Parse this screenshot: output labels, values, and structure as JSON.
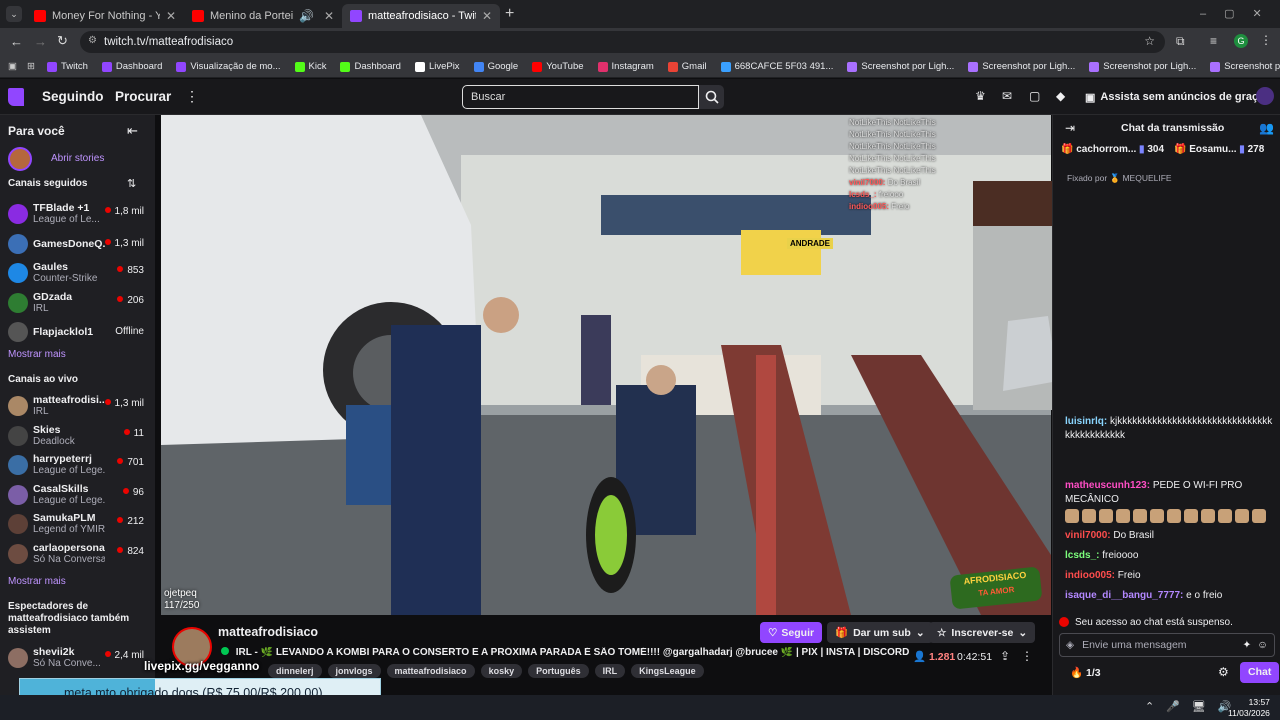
{
  "browser": {
    "tabs": [
      {
        "title": "Money For Nothing - YouTube",
        "color": "#ff0000"
      },
      {
        "title": "Menino da Porteira Versão Dire",
        "color": "#ff0000"
      },
      {
        "title": "matteafrodisiaco - Twitch",
        "color": "#9146ff"
      }
    ],
    "new_tab": "+",
    "url": "twitch.tv/matteafrodisiaco",
    "bookmarks": [
      {
        "label": "Twitch",
        "color": "#9146ff"
      },
      {
        "label": "Dashboard",
        "color": "#9146ff"
      },
      {
        "label": "Visualização de mo...",
        "color": "#9146ff"
      },
      {
        "label": "Kick",
        "color": "#53fc18"
      },
      {
        "label": "Dashboard",
        "color": "#53fc18"
      },
      {
        "label": "LivePix",
        "color": "#ffffff"
      },
      {
        "label": "Google",
        "color": "#4285f4"
      },
      {
        "label": "YouTube",
        "color": "#ff0000"
      },
      {
        "label": "Instagram",
        "color": "#e1306c"
      },
      {
        "label": "Gmail",
        "color": "#ea4335"
      },
      {
        "label": "668CAFCE 5F03 491...",
        "color": "#3aa0ff"
      },
      {
        "label": "Screenshot por Ligh...",
        "color": "#a970ff"
      },
      {
        "label": "Screenshot por Ligh...",
        "color": "#a970ff"
      },
      {
        "label": "Screenshot por Ligh...",
        "color": "#a970ff"
      },
      {
        "label": "Screenshot por Ligh...",
        "color": "#a970ff"
      }
    ],
    "profile_initial": "G"
  },
  "topnav": {
    "following": "Seguindo",
    "browse": "Procurar",
    "search_placeholder": "Buscar",
    "turbo": "Assista sem anúncios de graça"
  },
  "sidebar": {
    "title": "Para você",
    "stories": "Abrir stories",
    "followed_header": "Canais seguidos",
    "followed": [
      {
        "name": "TFBlade +1",
        "game": "League of Le...",
        "viewers": "1,8 mil",
        "live": true,
        "color": "#8a2be2"
      },
      {
        "name": "GamesDoneQ...",
        "game": "",
        "viewers": "1,3 mil",
        "live": true,
        "color": "#3b6fb6"
      },
      {
        "name": "Gaules",
        "game": "Counter-Strike",
        "viewers": "853",
        "live": true,
        "color": "#1e88e5"
      },
      {
        "name": "GDzada",
        "game": "IRL",
        "viewers": "206",
        "live": true,
        "color": "#2e7d32"
      },
      {
        "name": "Flapjacklol1",
        "game": "",
        "viewers": "Offline",
        "live": false,
        "color": "#555"
      }
    ],
    "show_more": "Mostrar mais",
    "live_header": "Canais ao vivo",
    "live": [
      {
        "name": "matteafrodisi...",
        "game": "IRL",
        "viewers": "1,3 mil",
        "color": "#aa8866"
      },
      {
        "name": "Skies",
        "game": "Deadlock",
        "viewers": "11",
        "color": "#444"
      },
      {
        "name": "harrypeterrj",
        "game": "League of Lege...",
        "viewers": "701",
        "color": "#3a6ea5"
      },
      {
        "name": "CasalSkills",
        "game": "League of Lege...",
        "viewers": "96",
        "color": "#7b5ea7"
      },
      {
        "name": "SamukaPLM",
        "game": "Legend of YMIR",
        "viewers": "212",
        "color": "#5d4037"
      },
      {
        "name": "carlaopersonal",
        "game": "Só Na Conversa",
        "viewers": "824",
        "color": "#6d4c41"
      }
    ],
    "show_more2": "Mostrar mais",
    "also_header": "Espectadores de matteafrodisiaco também assistem",
    "also": [
      {
        "name": "shevii2k",
        "game": "Só Na Conve...",
        "viewers": "2,4 mil",
        "color": "#8d6e63"
      }
    ]
  },
  "video": {
    "overlay_lines": [
      "NotLikeThis NotLikeThis",
      "NotLikeThis NotLikeThis",
      "NotLikeThis NotLikeThis",
      "NotLikeThis NotLikeThis",
      "NotLikeThis NotLikeThis"
    ],
    "overlay_chat": [
      {
        "user": "vinil7000:",
        "text": "Do Brasil"
      },
      {
        "user": "lcsds_:",
        "text": "freiooo"
      },
      {
        "user": "indioo005:",
        "text": "Freio"
      }
    ],
    "corner_user": "ojetpeq",
    "corner_count": "117/250",
    "shop_sign": "ANDRADE",
    "logo_text": "AFRODISIACO",
    "logo_sub": "TA AMOR"
  },
  "stream": {
    "channel": "matteafrodisiaco",
    "title": "IRL - 🌿 LEVANDO A KOMBI PARA O CONSERTO E A PRÓXIMA PARADA É SÃO TOMÉ!!!! @gargalhadarj @brucee 🌿 | PIX | INSTA | DISCORD",
    "follow": "Seguir",
    "sub": "Dar um sub",
    "subscribe": "Inscrever-se",
    "viewers": "1.281",
    "uptime": "0:42:51",
    "tags": [
      "dinnelerj",
      "jonvlogs",
      "matteafrodisiaco",
      "kosky",
      "Português",
      "IRL",
      "KingsLeague"
    ]
  },
  "donation": {
    "header": "livepix.gg/vegganno",
    "text": "meta mto obrigado dogs (R$ 75,00/R$ 200,00)",
    "progress": 0.375
  },
  "chat": {
    "title": "Chat da transmissão",
    "leaders": [
      {
        "name": "cachorrom...",
        "value": "304"
      },
      {
        "name": "Eosamu...",
        "value": "278"
      }
    ],
    "pinned": "Fixado por 🏅 MEQUELIFE",
    "messages": [
      {
        "user": "luisinrlq:",
        "color": "#8ad6ff",
        "text": "kjkkkkkkkkkkkkkkkkkkkkkkkkkkkkkkkkkkkkkkkkkkk"
      },
      {
        "user": "matheuscunh123:",
        "color": "#ff4ec5",
        "text": "PEDE O WI-FI PRO MECÂNICO"
      },
      {
        "user": "vinil7000:",
        "color": "#ff4d4d",
        "text": "Do Brasil"
      },
      {
        "user": "lcsds_:",
        "color": "#7cff7c",
        "text": "freioooo"
      },
      {
        "user": "indioo005:",
        "color": "#ff4d4d",
        "text": "Freio"
      },
      {
        "user": "isaque_di__bangu_7777:",
        "color": "#b388ff",
        "text": "e o freio"
      }
    ],
    "suspended": "Seu acesso ao chat está suspenso.",
    "input_placeholder": "Envie uma mensagem",
    "points": "1/3",
    "send": "Chat"
  },
  "taskbar": {
    "time": "13:57",
    "date": "11/03/2026"
  }
}
